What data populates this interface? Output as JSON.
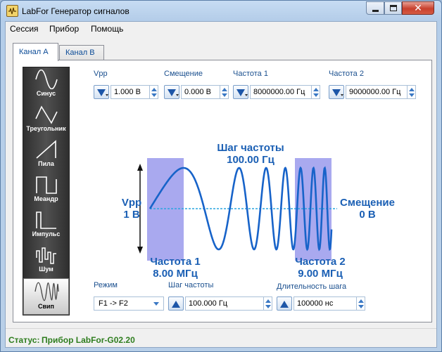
{
  "window": {
    "title": "LabFor Генератор сигналов",
    "close_glyph": "✕"
  },
  "menu": [
    "Сессия",
    "Прибор",
    "Помощь"
  ],
  "tabs": [
    {
      "label": "Канал A",
      "active": true
    },
    {
      "label": "Канал B",
      "active": false
    }
  ],
  "waveforms": [
    {
      "label": "Синус",
      "icon": "sine-wave-icon",
      "selected": false
    },
    {
      "label": "Треугольник",
      "icon": "triangle-wave-icon",
      "selected": false
    },
    {
      "label": "Пила",
      "icon": "sawtooth-wave-icon",
      "selected": false
    },
    {
      "label": "Меандр",
      "icon": "square-wave-icon",
      "selected": false
    },
    {
      "label": "Импульс",
      "icon": "pulse-wave-icon",
      "selected": false
    },
    {
      "label": "Шум",
      "icon": "noise-wave-icon",
      "selected": false
    },
    {
      "label": "Свип",
      "icon": "sweep-wave-icon",
      "selected": true
    }
  ],
  "params": {
    "vpp": {
      "label": "Vpp",
      "value": "1.000 В"
    },
    "offset": {
      "label": "Смещение",
      "value": "0.000 В"
    },
    "freq1": {
      "label": "Частота 1",
      "value": "8000000.00 Гц"
    },
    "freq2": {
      "label": "Частота 2",
      "value": "9000000.00 Гц"
    }
  },
  "diagram": {
    "step_title": "Шаг частоты",
    "step_value": "100.00 Гц",
    "vpp_title": "Vpp",
    "vpp_value": "1 В",
    "offset_title": "Смещение",
    "offset_value": "0 В",
    "f1_title": "Частота 1",
    "f1_value": "8.00 МГц",
    "f2_title": "Частота 2",
    "f2_value": "9.00 МГц"
  },
  "bottom": {
    "mode": {
      "label": "Режим",
      "value": "F1 -> F2"
    },
    "freq_step": {
      "label": "Шаг частоты",
      "value": "100.000 Гц"
    },
    "step_duration": {
      "label": "Длительность шага",
      "value": "100000 нс"
    }
  },
  "status": {
    "label": "Статус:",
    "value": "Прибор LabFor-G02.20"
  },
  "colors": {
    "accent": "#1a5fb4",
    "wave": "#1763c9",
    "band": "#a9a9ef",
    "status": "#2e7d1e"
  }
}
